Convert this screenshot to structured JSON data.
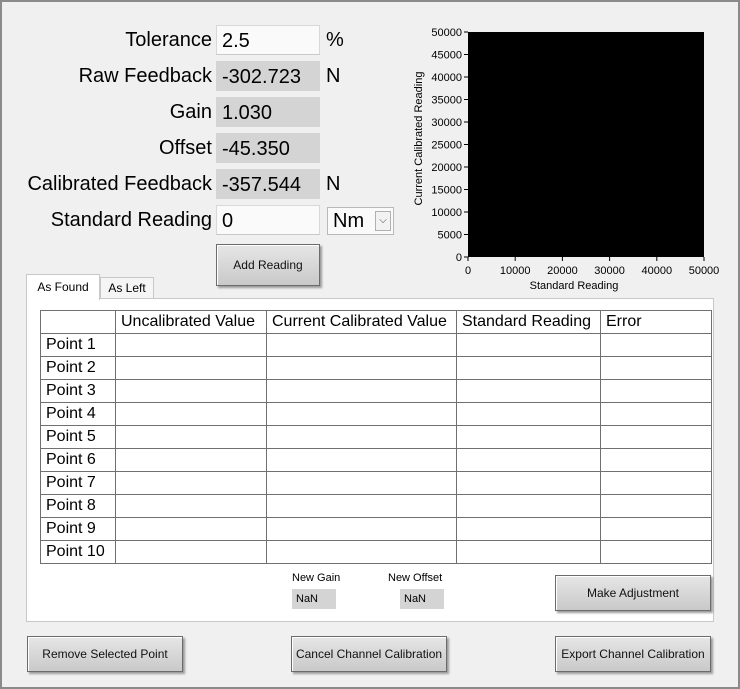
{
  "fields": {
    "tolerance": {
      "label": "Tolerance",
      "value": "2.5",
      "unit": "%"
    },
    "raw_feedback": {
      "label": "Raw Feedback",
      "value": "-302.723",
      "unit": "N"
    },
    "gain": {
      "label": "Gain",
      "value": "1.030"
    },
    "offset": {
      "label": "Offset",
      "value": "-45.350"
    },
    "calibrated_feedback": {
      "label": "Calibrated Feedback",
      "value": "-357.544",
      "unit": "N"
    },
    "standard_reading": {
      "label": "Standard Reading",
      "value": "0",
      "unit_selected": "Nm"
    }
  },
  "buttons": {
    "add_reading": "Add Reading",
    "make_adjustment": "Make Adjustment",
    "remove_selected_point": "Remove Selected Point",
    "cancel_channel_calibration": "Cancel Channel Calibration",
    "export_channel_calibration": "Export Channel Calibration"
  },
  "tabs": [
    {
      "label": "As Found",
      "active": true
    },
    {
      "label": "As Left",
      "active": false
    }
  ],
  "table": {
    "columns": [
      "",
      "Uncalibrated Value",
      "Current Calibrated Value",
      "Standard Reading",
      "Error"
    ],
    "rows": [
      "Point 1",
      "Point 2",
      "Point 3",
      "Point 4",
      "Point 5",
      "Point 6",
      "Point 7",
      "Point 8",
      "Point 9",
      "Point 10"
    ]
  },
  "new_gain": {
    "label": "New Gain",
    "value": "NaN"
  },
  "new_offset": {
    "label": "New Offset",
    "value": "NaN"
  },
  "chart_data": {
    "type": "scatter",
    "xlabel": "Standard Reading",
    "ylabel": "Current Calibrated Reading",
    "xlim": [
      0,
      50000
    ],
    "ylim": [
      0,
      50000
    ],
    "x_ticks": [
      "0",
      "10000",
      "20000",
      "30000",
      "40000",
      "50000"
    ],
    "y_ticks": [
      "0",
      "5000",
      "10000",
      "15000",
      "20000",
      "25000",
      "30000",
      "35000",
      "40000",
      "45000",
      "50000"
    ],
    "plot_background": "#000000",
    "points": []
  }
}
